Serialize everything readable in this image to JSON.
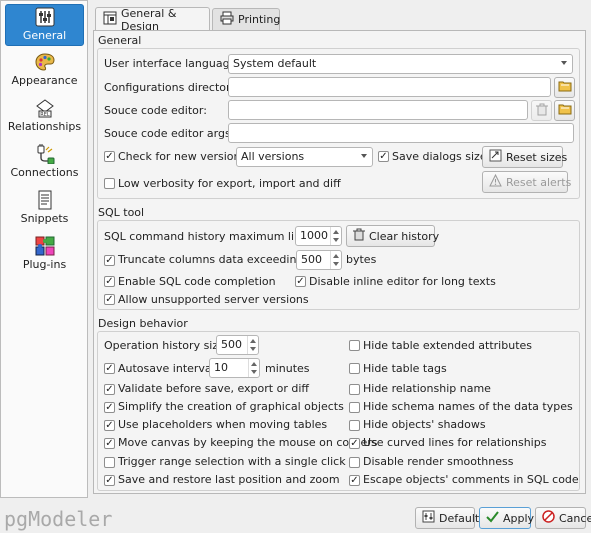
{
  "sidebar": {
    "items": [
      {
        "label": "General",
        "active": true,
        "icon": "sliders-icon"
      },
      {
        "label": "Appearance",
        "icon": "palette-icon"
      },
      {
        "label": "Relationships",
        "icon": "relationship-icon"
      },
      {
        "label": "Connections",
        "icon": "plug-icon"
      },
      {
        "label": "Snippets",
        "icon": "snippet-icon"
      },
      {
        "label": "Plug-ins",
        "icon": "puzzle-icon"
      }
    ]
  },
  "tabs": [
    {
      "label": "General & Design",
      "active": true,
      "icon": "design-icon"
    },
    {
      "label": "Printing",
      "icon": "printer-icon"
    }
  ],
  "general": {
    "title": "General",
    "ui_language_label": "User interface language:",
    "ui_language_value": "System default",
    "config_dir_label": "Configurations directory:",
    "config_dir_value": "",
    "source_editor_label": "Souce code editor:",
    "source_editor_value": "",
    "source_editor_args_label": "Souce code editor args:",
    "source_editor_args_value": "",
    "check_versions_label": "Check for new versions:",
    "check_versions_checked": true,
    "versions_value": "All versions",
    "save_dialogs_label": "Save dialogs sizes",
    "save_dialogs_checked": true,
    "reset_sizes_label": "Reset sizes",
    "low_verbosity_label": "Low verbosity for export, import and diff",
    "low_verbosity_checked": false,
    "reset_alerts_label": "Reset alerts"
  },
  "sql_tool": {
    "title": "SQL tool",
    "history_max_label": "SQL command history maximum lines:",
    "history_max_value": "1000",
    "clear_history_label": "Clear history",
    "truncate_label": "Truncate columns data exceeding:",
    "truncate_checked": true,
    "truncate_value": "500",
    "truncate_unit": "bytes",
    "completion_label": "Enable SQL code completion",
    "completion_checked": true,
    "disable_inline_label": "Disable inline editor for long texts",
    "disable_inline_checked": true,
    "unsupported_label": "Allow unsupported server versions",
    "unsupported_checked": true
  },
  "design": {
    "title": "Design behavior",
    "op_history_label": "Operation history size:",
    "op_history_value": "500",
    "autosave_label": "Autosave interval:",
    "autosave_checked": true,
    "autosave_value": "10",
    "autosave_unit": "minutes",
    "left": [
      {
        "label": "Validate before save, export or diff",
        "checked": true
      },
      {
        "label": "Simplify the creation of graphical objects",
        "checked": true
      },
      {
        "label": "Use placeholders when moving tables",
        "checked": true
      },
      {
        "label": "Move canvas by keeping the mouse on corners",
        "checked": true
      },
      {
        "label": "Trigger range selection with a single click",
        "checked": false
      },
      {
        "label": "Save and restore last position and zoom",
        "checked": true
      }
    ],
    "right": [
      {
        "label": "Hide table extended attributes",
        "checked": false
      },
      {
        "label": "Hide table tags",
        "checked": false
      },
      {
        "label": "Hide relationship name",
        "checked": false
      },
      {
        "label": "Hide schema names of the data types",
        "checked": false
      },
      {
        "label": "Hide objects' shadows",
        "checked": false
      },
      {
        "label": "Use curved lines for relationships",
        "checked": true
      },
      {
        "label": "Disable render smoothness",
        "checked": false
      },
      {
        "label": "Escape objects' comments in SQL code",
        "checked": true
      }
    ]
  },
  "footer": {
    "logo_text": "pgModeler",
    "defaults_label": "Defaults",
    "apply_label": "Apply",
    "cancel_label": "Cancel"
  }
}
